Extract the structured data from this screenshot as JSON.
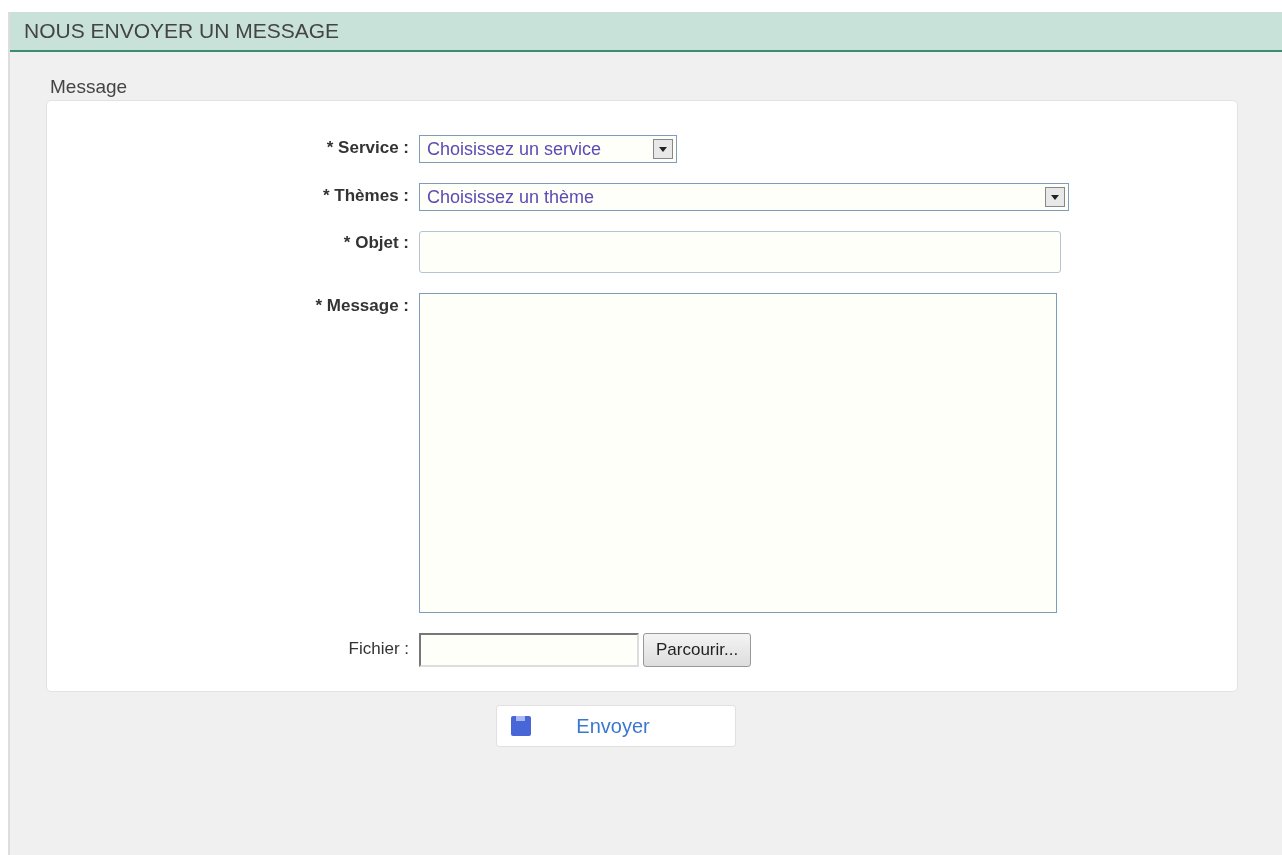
{
  "panel": {
    "title": "NOUS ENVOYER UN MESSAGE"
  },
  "fieldset": {
    "legend": "Message",
    "fields": [
      {
        "kind": "dropdown",
        "label": "* Service :",
        "required": true,
        "value": "Choisissez un service"
      },
      {
        "kind": "combobox",
        "label": "* Thèmes :",
        "required": true,
        "value": "Choisissez un thème"
      },
      {
        "kind": "text",
        "label": "* Objet :",
        "required": true
      },
      {
        "kind": "textarea",
        "label": "* Message :",
        "required": true
      },
      {
        "kind": "file",
        "label": "Fichier :",
        "required": false,
        "button": "Parcourir..."
      }
    ]
  },
  "submit": {
    "label": "Envoyer"
  }
}
